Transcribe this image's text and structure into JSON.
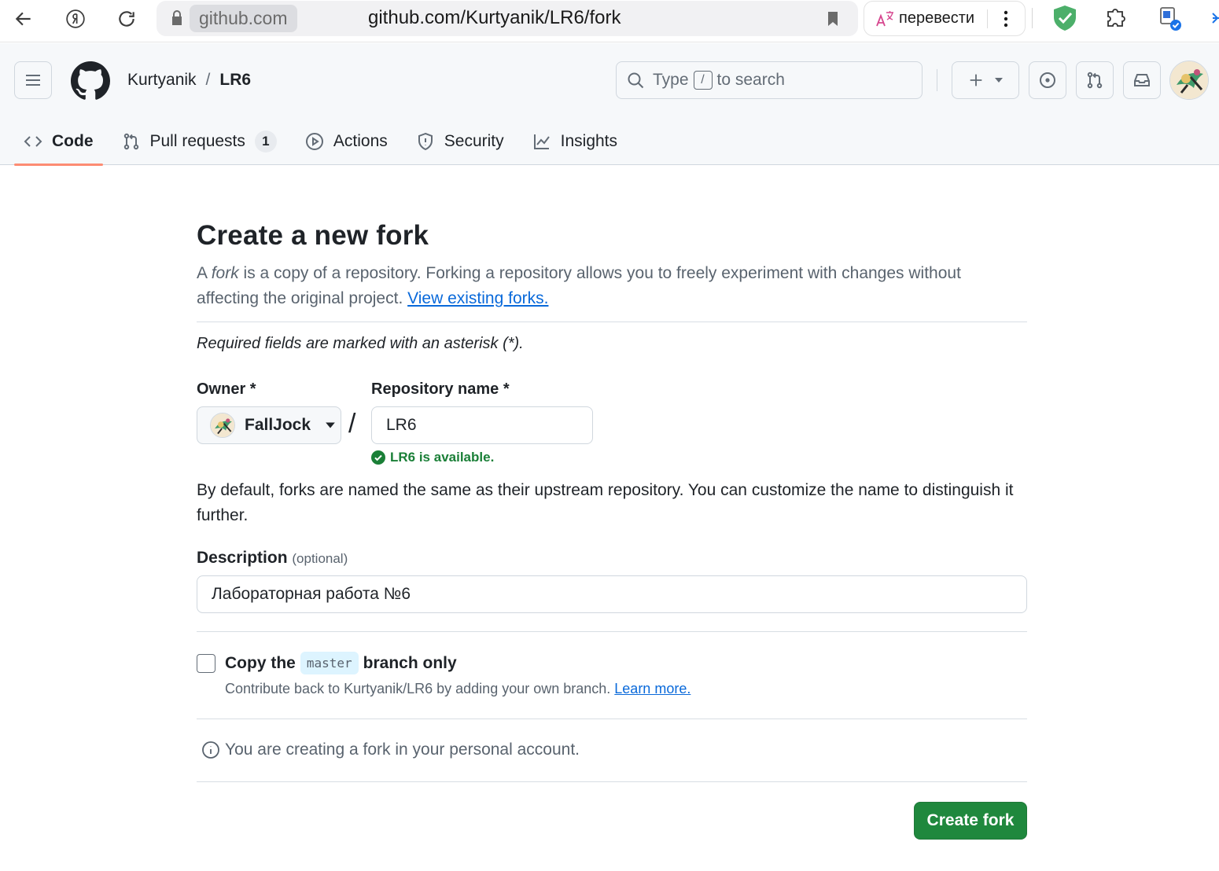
{
  "browser": {
    "host_chip": "github.com",
    "url": "github.com/Kurtyanik/LR6/fork",
    "translate_label": "перевести"
  },
  "header": {
    "owner": "Kurtyanik",
    "separator": "/",
    "repo": "LR6",
    "search": {
      "before": "Type",
      "key": "/",
      "after": "to search"
    }
  },
  "tabs": [
    {
      "label": "Code",
      "icon": "code-icon",
      "active": true
    },
    {
      "label": "Pull requests",
      "icon": "git-pull-request-icon",
      "count": "1"
    },
    {
      "label": "Actions",
      "icon": "play-icon"
    },
    {
      "label": "Security",
      "icon": "shield-icon"
    },
    {
      "label": "Insights",
      "icon": "graph-icon"
    }
  ],
  "form": {
    "title": "Create a new fork",
    "lead_a": "A ",
    "lead_fork": "fork",
    "lead_b": " is a copy of a repository. Forking a repository allows you to freely experiment with changes without affecting the original project. ",
    "view_forks": "View existing forks.",
    "required_note": "Required fields are marked with an asterisk (*).",
    "owner_label": "Owner *",
    "owner_value": "FallJock",
    "slash": "/",
    "repo_label": "Repository name *",
    "repo_value": "LR6",
    "available": "LR6 is available.",
    "default_note": "By default, forks are named the same as their upstream repository. You can customize the name to distinguish it further.",
    "desc_label": "Description",
    "desc_optional": "(optional)",
    "desc_value": "Лабораторная работа №6",
    "copy_a": "Copy the",
    "copy_branch": "master",
    "copy_b": "branch only",
    "copy_note": "Contribute back to Kurtyanik/LR6 by adding your own branch. ",
    "learn_more": "Learn more.",
    "personal_note": "You are creating a fork in your personal account.",
    "create_button": "Create fork"
  },
  "colors": {
    "primary_button": "#1f883d",
    "link": "#0969da",
    "success": "#1a7f37",
    "active_tab_underline": "#fd8c73"
  }
}
